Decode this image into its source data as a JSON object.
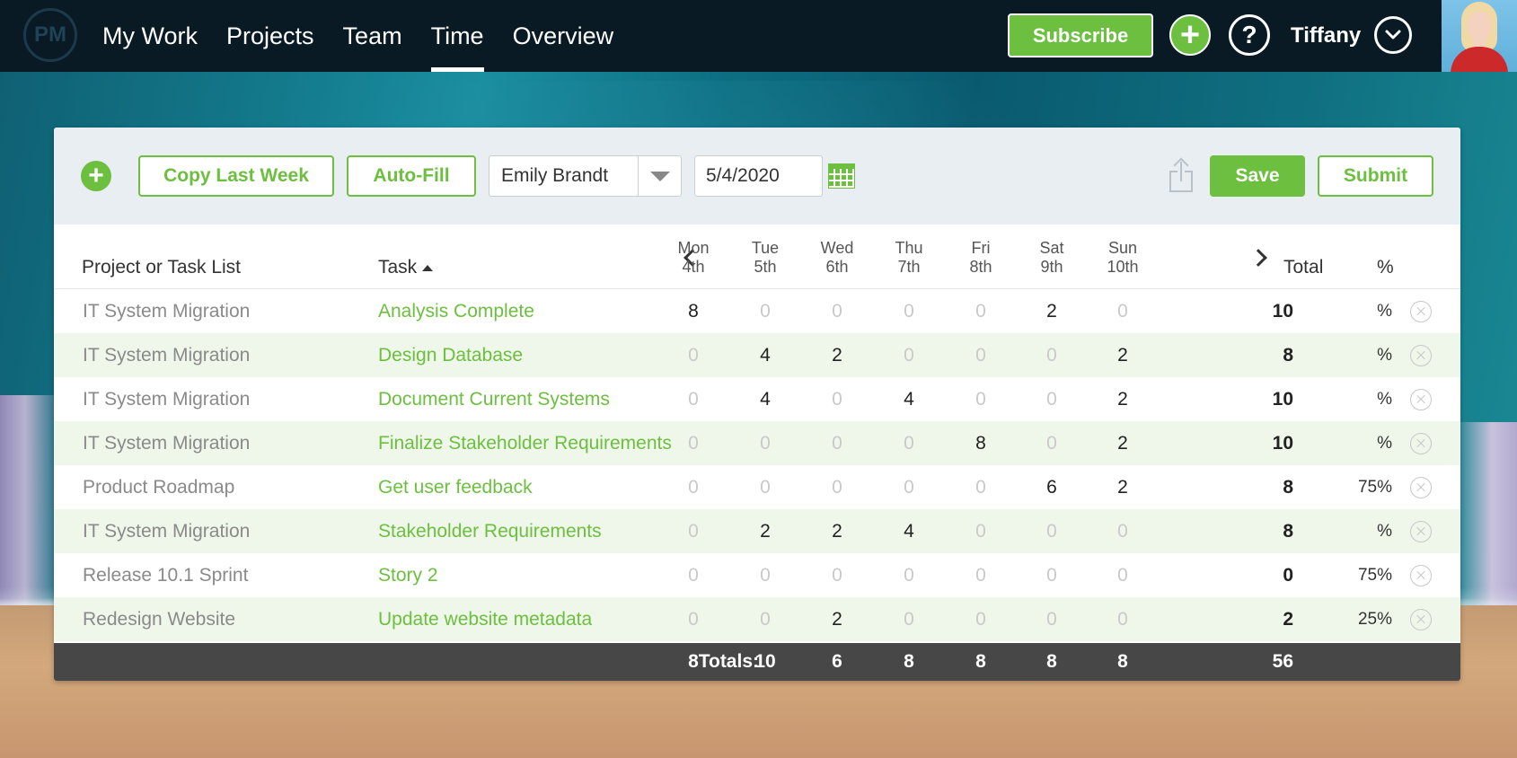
{
  "nav": {
    "logo": "PM",
    "items": [
      {
        "label": "My Work",
        "active": false
      },
      {
        "label": "Projects",
        "active": false
      },
      {
        "label": "Team",
        "active": false
      },
      {
        "label": "Time",
        "active": true
      },
      {
        "label": "Overview",
        "active": false
      }
    ],
    "subscribe_label": "Subscribe",
    "add_icon": "+",
    "help_icon": "?",
    "user_name": "Tiffany"
  },
  "toolbar": {
    "copy_label": "Copy Last Week",
    "autofill_label": "Auto-Fill",
    "person_select": "Emily Brandt",
    "date_value": "5/4/2020",
    "save_label": "Save",
    "submit_label": "Submit"
  },
  "table": {
    "headers": {
      "project": "Project or Task List",
      "task": "Task",
      "total": "Total",
      "pct": "%"
    },
    "days": [
      {
        "name": "Mon",
        "date": "4th"
      },
      {
        "name": "Tue",
        "date": "5th"
      },
      {
        "name": "Wed",
        "date": "6th"
      },
      {
        "name": "Thu",
        "date": "7th"
      },
      {
        "name": "Fri",
        "date": "8th"
      },
      {
        "name": "Sat",
        "date": "9th"
      },
      {
        "name": "Sun",
        "date": "10th"
      }
    ],
    "rows": [
      {
        "project": "IT System Migration",
        "task": "Analysis Complete",
        "hours": [
          "8",
          "0",
          "0",
          "0",
          "0",
          "2",
          "0"
        ],
        "total": "10",
        "pct": "%"
      },
      {
        "project": "IT System Migration",
        "task": "Design Database",
        "hours": [
          "0",
          "4",
          "2",
          "0",
          "0",
          "0",
          "2"
        ],
        "total": "8",
        "pct": "%"
      },
      {
        "project": "IT System Migration",
        "task": "Document Current Systems",
        "hours": [
          "0",
          "4",
          "0",
          "4",
          "0",
          "0",
          "2"
        ],
        "total": "10",
        "pct": "%"
      },
      {
        "project": "IT System Migration",
        "task": "Finalize Stakeholder Requirements",
        "hours": [
          "0",
          "0",
          "0",
          "0",
          "8",
          "0",
          "2"
        ],
        "total": "10",
        "pct": "%"
      },
      {
        "project": "Product Roadmap",
        "task": "Get user feedback",
        "hours": [
          "0",
          "0",
          "0",
          "0",
          "0",
          "6",
          "2"
        ],
        "total": "8",
        "pct": "75%"
      },
      {
        "project": "IT System Migration",
        "task": "Stakeholder Requirements",
        "hours": [
          "0",
          "2",
          "2",
          "4",
          "0",
          "0",
          "0"
        ],
        "total": "8",
        "pct": "%"
      },
      {
        "project": "Release 10.1 Sprint",
        "task": "Story 2",
        "hours": [
          "0",
          "0",
          "0",
          "0",
          "0",
          "0",
          "0"
        ],
        "total": "0",
        "pct": "75%"
      },
      {
        "project": "Redesign Website",
        "task": "Update website metadata",
        "hours": [
          "0",
          "0",
          "2",
          "0",
          "0",
          "0",
          "0"
        ],
        "total": "2",
        "pct": "25%"
      }
    ],
    "totals": {
      "label": "Totals:",
      "days": [
        "8",
        "10",
        "6",
        "8",
        "8",
        "8",
        "8"
      ],
      "grand": "56"
    }
  }
}
